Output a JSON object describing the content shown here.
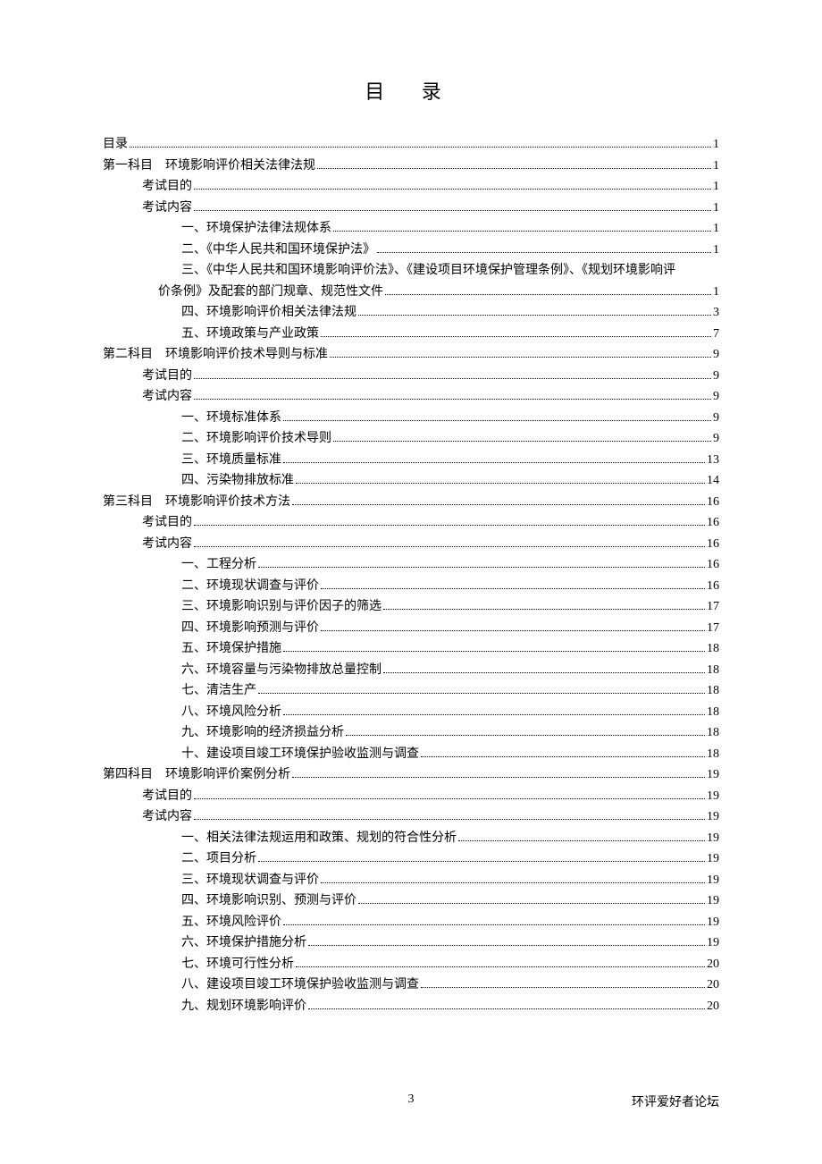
{
  "title": "目 录",
  "footer": {
    "page": "3",
    "source": "环评爱好者论坛"
  },
  "toc": [
    {
      "indent": 0,
      "label": "目录",
      "page": "1"
    },
    {
      "indent": 0,
      "label": "第一科目　环境影响评价相关法律法规",
      "page": "1"
    },
    {
      "indent": 1,
      "label": "考试目的",
      "page": "1"
    },
    {
      "indent": 1,
      "label": "考试内容",
      "page": "1"
    },
    {
      "indent": 2,
      "label": "一、环境保护法律法规体系",
      "page": "1"
    },
    {
      "indent": 2,
      "label": "二、《中华人民共和国环境保护法》",
      "page": "1"
    },
    {
      "indent": 2,
      "label": "三、《中华人民共和国环境影响评价法》、《建设项目环境保护管理条例》、《规划环境影响评",
      "page": "",
      "nodots": true
    },
    {
      "indent": 1,
      "indent_class": "indent-2b",
      "label": "价条例》及配套的部门规章、规范性文件",
      "page": "1"
    },
    {
      "indent": 2,
      "label": "四、环境影响评价相关法律法规",
      "page": "3"
    },
    {
      "indent": 2,
      "label": "五、环境政策与产业政策",
      "page": "7"
    },
    {
      "indent": 0,
      "label": "第二科目　环境影响评价技术导则与标准",
      "page": "9"
    },
    {
      "indent": 1,
      "label": "考试目的",
      "page": "9"
    },
    {
      "indent": 1,
      "label": "考试内容",
      "page": "9"
    },
    {
      "indent": 2,
      "label": "一、环境标准体系",
      "page": "9"
    },
    {
      "indent": 2,
      "label": "二、环境影响评价技术导则",
      "page": "9"
    },
    {
      "indent": 2,
      "label": "三、环境质量标准",
      "page": "13"
    },
    {
      "indent": 2,
      "label": "四、污染物排放标准",
      "page": "14"
    },
    {
      "indent": 0,
      "label": "第三科目　环境影响评价技术方法",
      "page": "16"
    },
    {
      "indent": 1,
      "label": "考试目的",
      "page": "16"
    },
    {
      "indent": 1,
      "label": "考试内容",
      "page": "16"
    },
    {
      "indent": 2,
      "label": "一、工程分析",
      "page": "16"
    },
    {
      "indent": 2,
      "label": "二、环境现状调查与评价",
      "page": "16"
    },
    {
      "indent": 2,
      "label": "三、环境影响识别与评价因子的筛选",
      "page": "17"
    },
    {
      "indent": 2,
      "label": "四、环境影响预测与评价",
      "page": "17"
    },
    {
      "indent": 2,
      "label": "五、环境保护措施",
      "page": "18"
    },
    {
      "indent": 2,
      "label": "六、环境容量与污染物排放总量控制",
      "page": "18"
    },
    {
      "indent": 2,
      "label": "七、清洁生产",
      "page": "18"
    },
    {
      "indent": 2,
      "label": "八、环境风险分析",
      "page": "18"
    },
    {
      "indent": 2,
      "label": "九、环境影响的经济损益分析",
      "page": "18"
    },
    {
      "indent": 2,
      "label": "十、建设项目竣工环境保护验收监测与调查",
      "page": "18"
    },
    {
      "indent": 0,
      "label": "第四科目　环境影响评价案例分析",
      "page": "19"
    },
    {
      "indent": 1,
      "label": "考试目的",
      "page": "19"
    },
    {
      "indent": 1,
      "label": "考试内容",
      "page": "19"
    },
    {
      "indent": 2,
      "label": "一、相关法律法规运用和政策、规划的符合性分析",
      "page": "19"
    },
    {
      "indent": 2,
      "label": "二、项目分析",
      "page": "19"
    },
    {
      "indent": 2,
      "label": "三、环境现状调查与评价",
      "page": "19"
    },
    {
      "indent": 2,
      "label": "四、环境影响识别、预测与评价",
      "page": "19"
    },
    {
      "indent": 2,
      "label": "五、环境风险评价",
      "page": "19"
    },
    {
      "indent": 2,
      "label": "六、环境保护措施分析",
      "page": "19"
    },
    {
      "indent": 2,
      "label": "七、环境可行性分析",
      "page": "20"
    },
    {
      "indent": 2,
      "label": "八、建设项目竣工环境保护验收监测与调查",
      "page": "20"
    },
    {
      "indent": 2,
      "label": "九、规划环境影响评价",
      "page": "20"
    }
  ]
}
